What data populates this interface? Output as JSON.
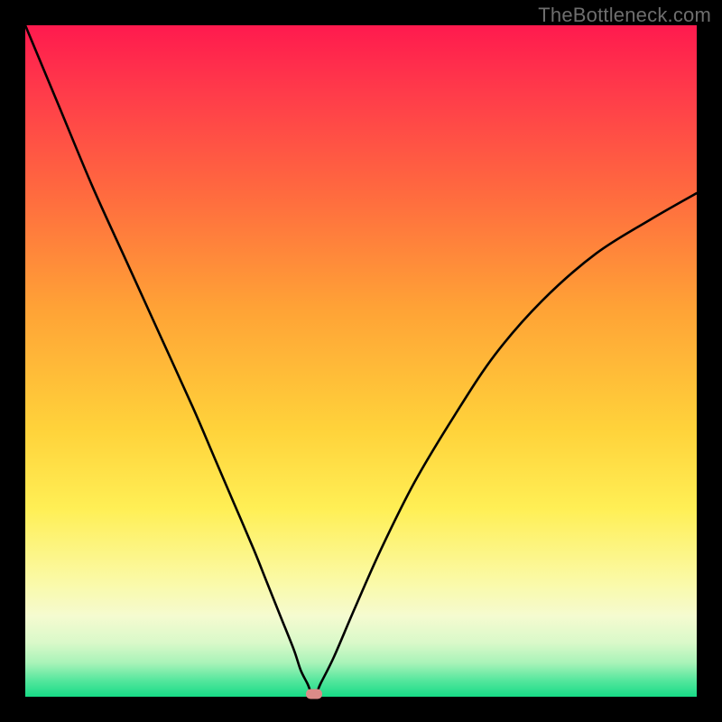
{
  "watermark": "TheBottleneck.com",
  "chart_data": {
    "type": "line",
    "title": "",
    "xlabel": "",
    "ylabel": "",
    "xlim": [
      0,
      100
    ],
    "ylim": [
      0,
      100
    ],
    "grid": false,
    "notes": "Background is a vertical heat gradient from red (top) through orange/yellow to green (bottom). A single black V-shaped curve drops from upper-left, reaches its minimum near x≈43, y≈0 and rises to the upper-right. A small rounded pink marker sits at the curve minimum.",
    "series": [
      {
        "name": "bottleneck-curve",
        "x": [
          0,
          5,
          10,
          15,
          20,
          25,
          28,
          31,
          34,
          36,
          38,
          40,
          41,
          42,
          43,
          44,
          46,
          49,
          53,
          58,
          64,
          70,
          77,
          85,
          93,
          100
        ],
        "values": [
          100,
          88,
          76,
          65,
          54,
          43,
          36,
          29,
          22,
          17,
          12,
          7,
          4,
          2,
          0,
          2,
          6,
          13,
          22,
          32,
          42,
          51,
          59,
          66,
          71,
          75
        ]
      }
    ],
    "marker": {
      "x": 43,
      "y": 0,
      "color": "#db8b88"
    }
  }
}
